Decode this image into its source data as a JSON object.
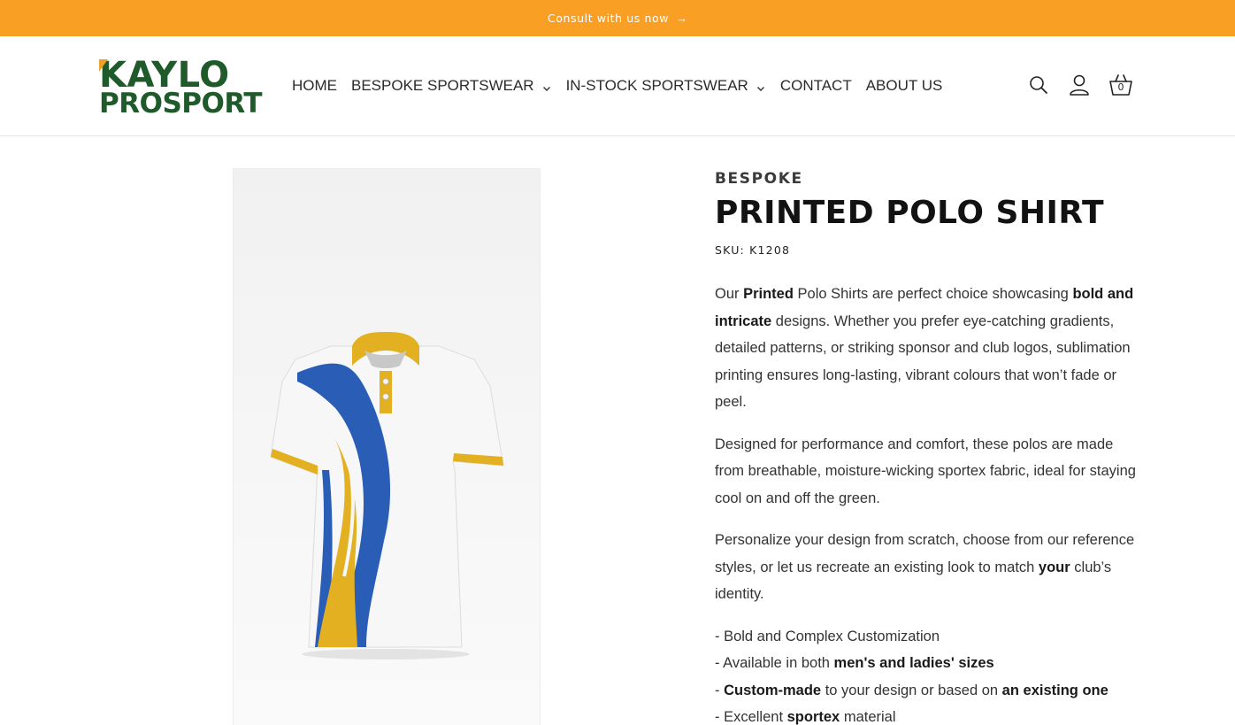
{
  "announcement": {
    "text": "Consult with us now",
    "arrow": "→"
  },
  "brand": {
    "line1": "KAYLO",
    "line2": "PROSPORT",
    "green": "#1f5a2a",
    "orange": "#f0a02a"
  },
  "nav": {
    "items": [
      {
        "label": "HOME",
        "has_dropdown": false
      },
      {
        "label": "BESPOKE SPORTSWEAR",
        "has_dropdown": true
      },
      {
        "label": "IN-STOCK SPORTSWEAR",
        "has_dropdown": true
      },
      {
        "label": "CONTACT",
        "has_dropdown": false
      },
      {
        "label": "ABOUT US",
        "has_dropdown": false
      }
    ]
  },
  "header_icons": {
    "search": "search-icon",
    "account": "account-icon",
    "cart": "cart-icon",
    "cart_count": "0"
  },
  "product": {
    "eyebrow": "BESPOKE",
    "title": "PRINTED POLO SHIRT",
    "sku": "SKU: K1208",
    "paragraphs": [
      [
        {
          "t": "Our ",
          "b": false
        },
        {
          "t": "Printed",
          "b": true
        },
        {
          "t": " Polo Shirts are perfect choice showcasing ",
          "b": false
        },
        {
          "t": "bold and intricate",
          "b": true
        },
        {
          "t": " designs. Whether you prefer eye-catching gradients, detailed patterns, or striking sponsor and club logos, sublimation printing ensures long-lasting, vibrant colours that won’t fade or peel.",
          "b": false
        }
      ],
      [
        {
          "t": "Designed for performance and comfort, these polos are made from breathable, moisture-wicking sportex fabric, ideal for staying cool on and off the green.",
          "b": false
        }
      ],
      [
        {
          "t": "Personalize your design from scratch, choose from our reference styles, or let us recreate an existing look to match ",
          "b": false
        },
        {
          "t": "your",
          "b": true
        },
        {
          "t": " club’s identity.",
          "b": false
        }
      ]
    ],
    "bullets": [
      [
        {
          "t": "- Bold and Complex Customization",
          "b": false
        }
      ],
      [
        {
          "t": "- Available in both ",
          "b": false
        },
        {
          "t": "men's and ladies' sizes",
          "b": true
        }
      ],
      [
        {
          "t": "- ",
          "b": false
        },
        {
          "t": "Custom-made",
          "b": true
        },
        {
          "t": " to your design or based on ",
          "b": false
        },
        {
          "t": "an existing one",
          "b": true
        }
      ],
      [
        {
          "t": "- Excellent ",
          "b": false
        },
        {
          "t": "sportex",
          "b": true
        },
        {
          "t": " material",
          "b": false
        }
      ]
    ]
  },
  "colors": {
    "announcement_bg": "#f89f24",
    "polo_blue": "#2a5db5",
    "polo_yellow": "#e2b021"
  }
}
